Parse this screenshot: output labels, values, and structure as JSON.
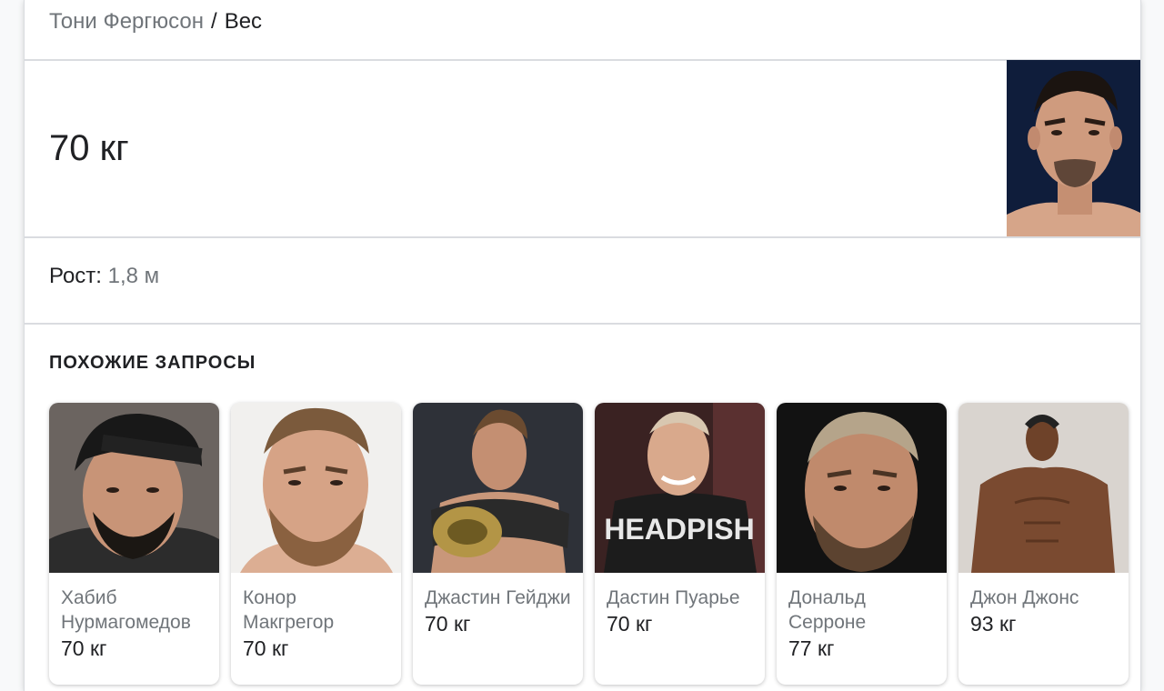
{
  "breadcrumb": {
    "parent": "Тони Фергюсон",
    "separator": "/",
    "current": "Вес"
  },
  "answer": {
    "value": "70 кг"
  },
  "height": {
    "label": "Рост:",
    "value": "1,8 м"
  },
  "related": {
    "title": "ПОХОЖИЕ ЗАПРОСЫ",
    "items": [
      {
        "name": "Хабиб Нурмагомедов",
        "value": "70 кг"
      },
      {
        "name": "Конор Макгрегор",
        "value": "70 кг"
      },
      {
        "name": "Джастин Гейджи",
        "value": "70 кг"
      },
      {
        "name": "Дастин Пуарье",
        "value": "70 кг"
      },
      {
        "name": "Дональд Серроне",
        "value": "77 кг"
      },
      {
        "name": "Джон Джонс",
        "value": "93 кг"
      }
    ]
  }
}
